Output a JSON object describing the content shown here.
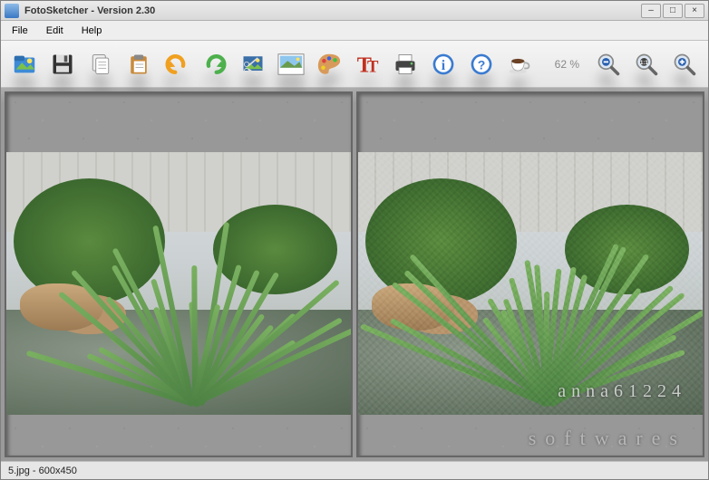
{
  "title": "FotoSketcher - Version 2.30",
  "menu": {
    "file": "File",
    "edit": "Edit",
    "help": "Help"
  },
  "toolbar": {
    "open": "open-icon",
    "save": "save-icon",
    "copy": "copy-icon",
    "paste": "paste-icon",
    "undo": "undo-icon",
    "redo": "redo-icon",
    "crop": "crop-icon",
    "image": "image-icon",
    "palette": "palette-icon",
    "text": "text-icon",
    "print": "print-icon",
    "info": "info-icon",
    "helpq": "help-icon",
    "coffee": "coffee-icon",
    "zoom_label": "62 %",
    "zoom_out": "zoom-out-icon",
    "zoom_fit": "zoom-fit-icon",
    "zoom_in": "zoom-in-icon"
  },
  "panes": {
    "left": {
      "label": "source-image"
    },
    "right": {
      "label": "result-image",
      "watermark_top": "anna61224",
      "watermark_bottom": "softwares"
    }
  },
  "status": "5.jpg - 600x450",
  "window_buttons": {
    "min": "–",
    "max": "□",
    "close": "×"
  }
}
